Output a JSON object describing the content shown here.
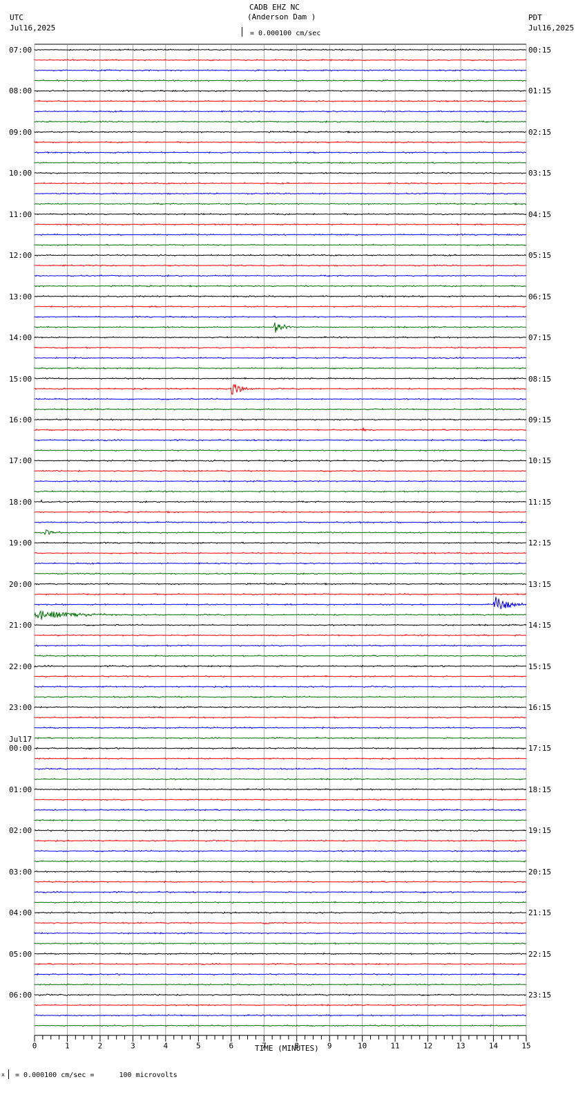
{
  "header": {
    "station": "CADB EHZ NC",
    "location": "(Anderson Dam )",
    "scale_text": "= 0.000100 cm/sec",
    "left_zone": "UTC",
    "left_date": "Jul16,2025",
    "right_zone": "PDT",
    "right_date": "Jul16,2025"
  },
  "footer": {
    "scale_prefix": "x",
    "scale_text": "= 0.000100 cm/sec =      100 microvolts"
  },
  "chart_data": {
    "type": "line",
    "xlabel": "TIME (MINUTES)",
    "xlim": [
      0,
      15
    ],
    "x_ticks": [
      "0",
      "1",
      "2",
      "3",
      "4",
      "5",
      "6",
      "7",
      "8",
      "9",
      "10",
      "11",
      "12",
      "13",
      "14",
      "15"
    ],
    "trace_minutes": 15,
    "traces_per_hour": 4,
    "trace_colors": [
      "#000000",
      "#ff0000",
      "#0000ff",
      "#007000"
    ],
    "left_labels": [
      "07:00",
      "08:00",
      "09:00",
      "10:00",
      "11:00",
      "12:00",
      "13:00",
      "14:00",
      "15:00",
      "16:00",
      "17:00",
      "18:00",
      "19:00",
      "20:00",
      "21:00",
      "22:00",
      "23:00",
      "00:00",
      "01:00",
      "02:00",
      "03:00",
      "04:00",
      "05:00",
      "06:00"
    ],
    "date_change_label": "Jul17",
    "right_labels": [
      "00:15",
      "01:15",
      "02:15",
      "03:15",
      "04:15",
      "05:15",
      "06:15",
      "07:15",
      "08:15",
      "09:15",
      "10:15",
      "11:15",
      "12:15",
      "13:15",
      "14:15",
      "15:15",
      "16:15",
      "17:15",
      "18:15",
      "19:15",
      "20:15",
      "21:15",
      "22:15",
      "23:15"
    ],
    "events": [
      {
        "utc": "13:45",
        "start_min": 7.3,
        "end_min": 8.0,
        "amplitude": 0.6
      },
      {
        "utc": "15:15",
        "start_min": 6.0,
        "end_min": 6.7,
        "amplitude": 0.75
      },
      {
        "utc": "16:15",
        "start_min": 10.0,
        "end_min": 10.3,
        "amplitude": 0.25
      },
      {
        "utc": "18:00",
        "start_min": 0.2,
        "end_min": 0.4,
        "amplitude": 0.2
      },
      {
        "utc": "18:45",
        "start_min": 0.3,
        "end_min": 0.9,
        "amplitude": 0.3
      },
      {
        "utc": "20:30",
        "start_min": 14.0,
        "end_min": 15.0,
        "amplitude": 0.9
      },
      {
        "utc": "20:45",
        "start_min": 0.0,
        "end_min": 3.0,
        "amplitude": 0.45
      },
      {
        "utc": "04:15",
        "start_min": 7.0,
        "end_min": 7.5,
        "amplitude": 0.15
      }
    ]
  }
}
